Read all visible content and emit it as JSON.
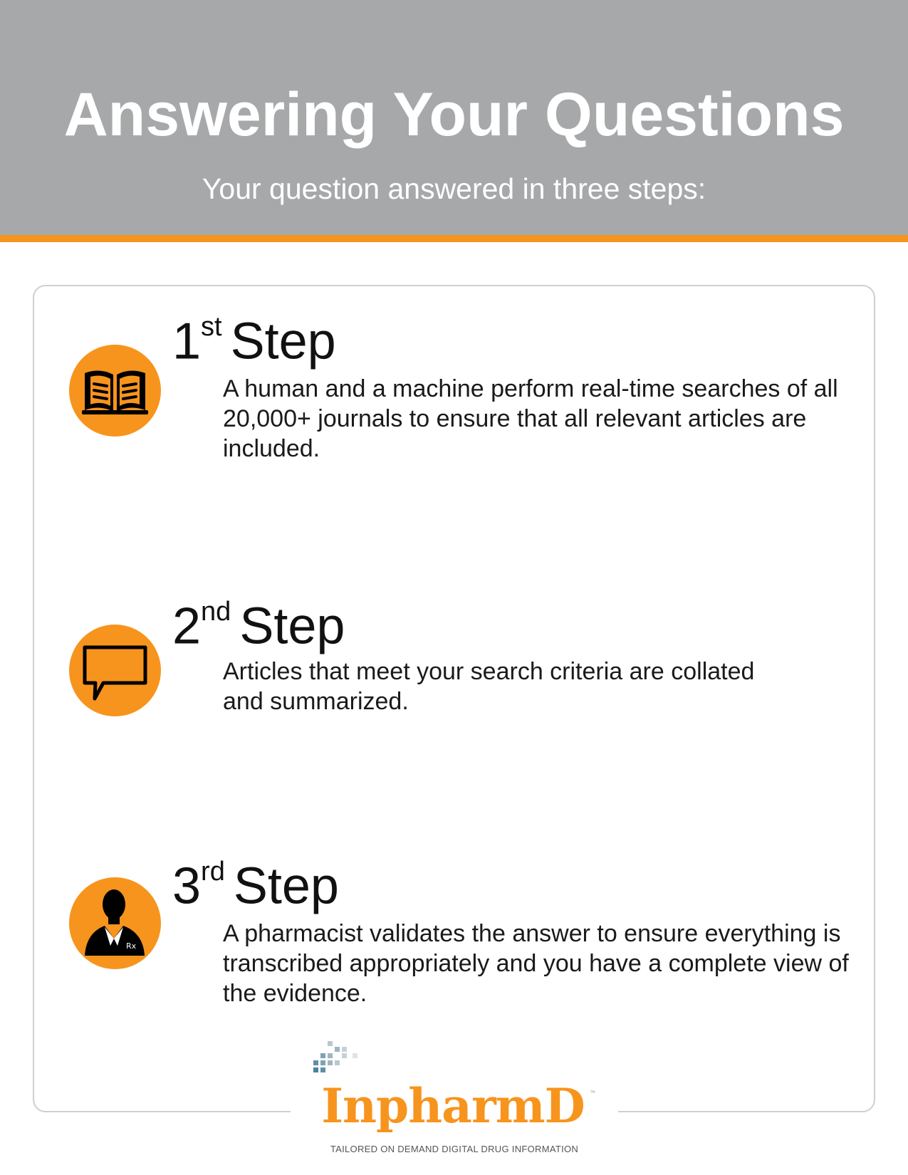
{
  "header": {
    "title": "Answering Your Questions",
    "subtitle": "Your question answered in three steps:"
  },
  "colors": {
    "accent": "#f7941d",
    "header_bg": "#a7a8aa",
    "text": "#1a1a1a"
  },
  "steps": [
    {
      "number": "1",
      "suffix": "st",
      "word": "Step",
      "icon": "open-book-icon",
      "text": "A human and a machine perform real-time searches of all 20,000+ journals to ensure that all relevant articles are included."
    },
    {
      "number": "2",
      "suffix": "nd",
      "word": "Step",
      "icon": "speech-bubble-icon",
      "text": "Articles that meet your search criteria are collated and summarized."
    },
    {
      "number": "3",
      "suffix": "rd",
      "word": "Step",
      "icon": "pharmacist-icon",
      "icon_label": "Rx",
      "text": "A pharmacist validates the answer to ensure everything is transcribed appropriately and you have a complete view of the evidence."
    }
  ],
  "logo": {
    "wordmark": "InpharmD",
    "trademark": "™",
    "tagline": "TAILORED ON DEMAND DIGITAL DRUG INFORMATION"
  }
}
